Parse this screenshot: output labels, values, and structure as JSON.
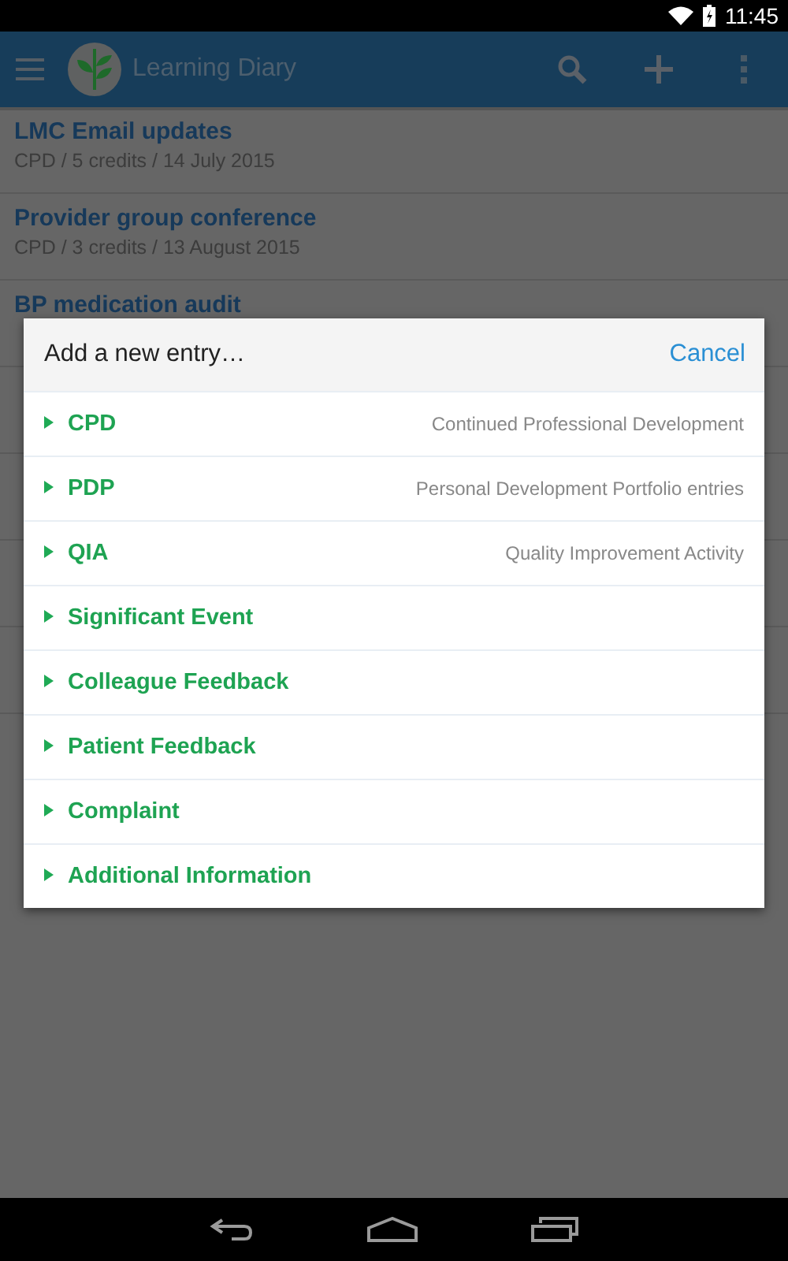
{
  "status_bar": {
    "time": "11:45"
  },
  "app_bar": {
    "title": "Learning Diary"
  },
  "entries": [
    {
      "title": "LMC Email updates",
      "subtitle": "CPD / 5 credits / 14 July 2015"
    },
    {
      "title": "Provider group conference",
      "subtitle": "CPD / 3 credits / 13 August 2015"
    },
    {
      "title": "BP medication audit"
    }
  ],
  "dialog": {
    "title": "Add a new entry…",
    "cancel": "Cancel",
    "options": [
      {
        "label": "CPD",
        "description": "Continued Professional Development"
      },
      {
        "label": "PDP",
        "description": "Personal Development Portfolio entries"
      },
      {
        "label": "QIA",
        "description": "Quality Improvement Activity"
      },
      {
        "label": "Significant Event"
      },
      {
        "label": "Colleague Feedback"
      },
      {
        "label": "Patient Feedback"
      },
      {
        "label": "Complaint"
      },
      {
        "label": "Additional Information"
      }
    ]
  }
}
